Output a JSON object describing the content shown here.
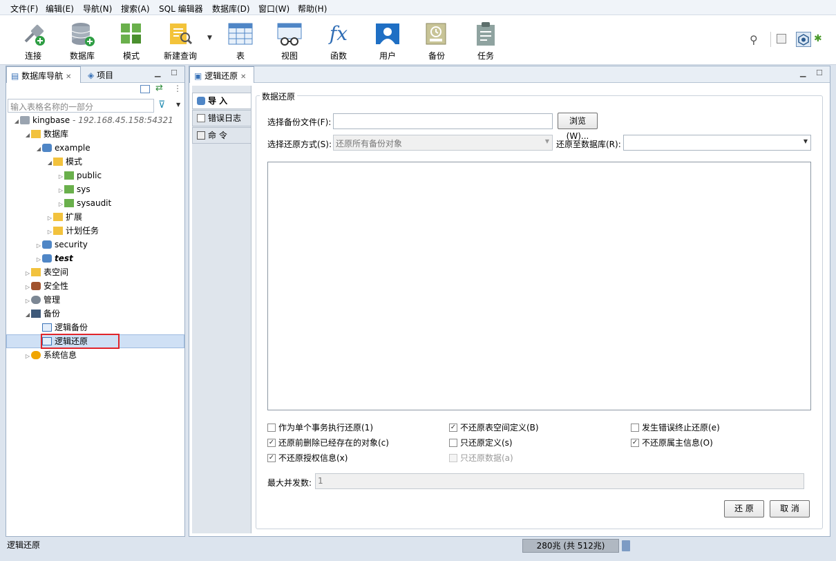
{
  "menu": [
    "文件(F)",
    "编辑(E)",
    "导航(N)",
    "搜索(A)",
    "SQL 编辑器",
    "数据库(D)",
    "窗口(W)",
    "帮助(H)"
  ],
  "toolbar": {
    "connect": "连接",
    "database": "数据库",
    "schema": "模式",
    "new_query": "新建查询",
    "table": "表",
    "view": "视图",
    "function": "函数",
    "user": "用户",
    "backup": "备份",
    "task": "任务",
    "function_symbol": "fx"
  },
  "nav": {
    "tab_db_nav": "数据库导航",
    "tab_project": "项目",
    "filter_placeholder": "输入表格名称的一部分",
    "tree": {
      "conn_name": "kingbase",
      "conn_host": " - 192.168.45.158:54321",
      "databases": "数据库",
      "example": "example",
      "schemas": "模式",
      "public": "public",
      "sys": "sys",
      "sysaudit": "sysaudit",
      "extension": "扩展",
      "scheduled": "计划任务",
      "security_db": "security",
      "test_db": "test",
      "tablespace": "表空间",
      "security": "安全性",
      "admin": "管理",
      "backup": "备份",
      "logical_backup": "逻辑备份",
      "logical_restore": "逻辑还原",
      "sysinfo": "系统信息"
    }
  },
  "editor": {
    "tab_title": "逻辑还原",
    "side_tabs": [
      "导 入",
      "错误日志",
      "命 令"
    ],
    "group_title": "数据还原",
    "backup_file_label": "选择备份文件(F):",
    "backup_file_value": "",
    "browse": "浏览(W)...",
    "restore_mode_label": "选择还原方式(S):",
    "restore_mode_value": "还原所有备份对象",
    "restore_to_label": "还原至数据库(R):",
    "restore_to_value": "",
    "options": [
      {
        "label": "作为单个事务执行还原(1)",
        "checked": false,
        "enabled": true
      },
      {
        "label": "不还原表空间定义(B)",
        "checked": true,
        "enabled": true
      },
      {
        "label": "发生错误终止还原(e)",
        "checked": false,
        "enabled": true
      },
      {
        "label": "还原前删除已经存在的对象(c)",
        "checked": true,
        "enabled": true
      },
      {
        "label": "只还原定义(s)",
        "checked": false,
        "enabled": true
      },
      {
        "label": "不还原属主信息(O)",
        "checked": true,
        "enabled": true
      },
      {
        "label": "不还原授权信息(x)",
        "checked": true,
        "enabled": true
      },
      {
        "label": "只还原数据(a)",
        "checked": false,
        "enabled": false
      }
    ],
    "max_concurrency_label": "最大并发数:",
    "max_concurrency_value": "1",
    "restore_button": "还 原",
    "cancel_button": "取 消"
  },
  "status": {
    "left_text": "逻辑还原",
    "memory": "280兆 (共 512兆)"
  },
  "colors": {
    "accent": "#3a73b8",
    "highlight_border": "#e0242a",
    "selection": "#cfe0f5"
  }
}
